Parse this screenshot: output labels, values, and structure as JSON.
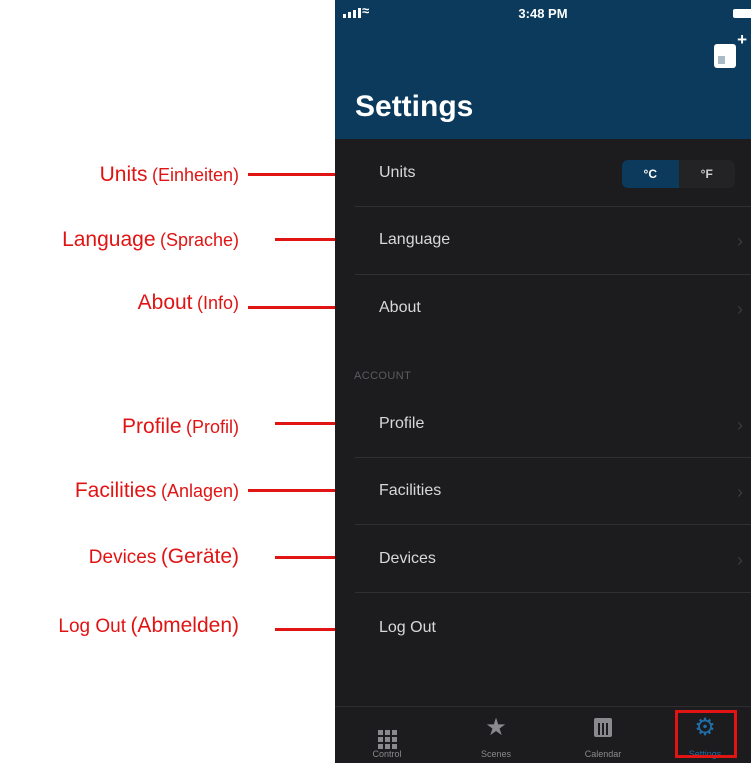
{
  "status_bar": {
    "time": "3:48 PM"
  },
  "header": {
    "title": "Settings",
    "add_device_icon": "add-device-icon"
  },
  "settings": {
    "units_label": "Units",
    "units_options": [
      "°C",
      "°F"
    ],
    "units_selected": "°C",
    "language_label": "Language",
    "about_label": "About"
  },
  "account": {
    "section_title": "ACCOUNT",
    "profile_label": "Profile",
    "facilities_label": "Facilities",
    "devices_label": "Devices",
    "logout_label": "Log Out"
  },
  "tabbar": {
    "tabs": [
      {
        "label": "Control",
        "icon": "grid-icon"
      },
      {
        "label": "Scenes",
        "icon": "star-icon"
      },
      {
        "label": "Calendar",
        "icon": "calendar-icon"
      },
      {
        "label": "Settings",
        "icon": "gear-icon"
      }
    ],
    "active": "Settings"
  },
  "annotations": [
    {
      "main": "Units",
      "sub": "(Einheiten)"
    },
    {
      "main": "Language",
      "sub": "(Sprache)"
    },
    {
      "main": "About",
      "sub": "(Info)"
    },
    {
      "main": "Profile",
      "sub": "(Profil)"
    },
    {
      "main": "Facilities",
      "sub": "(Anlagen)"
    },
    {
      "main": "Devices",
      "sub": "(Geräte)"
    },
    {
      "main": "Log Out",
      "sub": "(Abmelden)"
    }
  ],
  "colors": {
    "header": "#0b3a5c",
    "background": "#1c1c1e",
    "annotation": "#e11414",
    "active_tab": "#1e6ea8"
  }
}
